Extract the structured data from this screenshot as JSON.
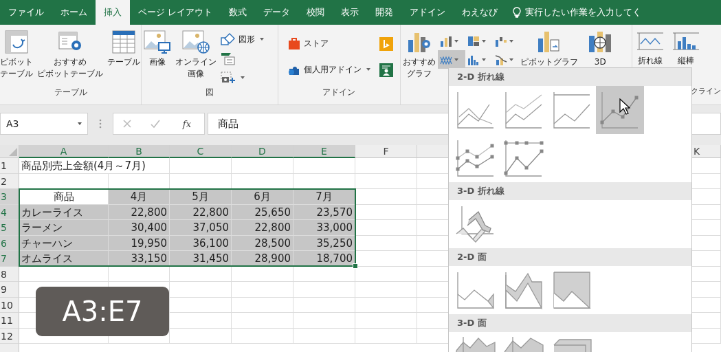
{
  "tabs": [
    {
      "label": "ファイル",
      "selected": false
    },
    {
      "label": "ホーム",
      "selected": false
    },
    {
      "label": "挿入",
      "selected": true
    },
    {
      "label": "ページ レイアウト",
      "selected": false
    },
    {
      "label": "数式",
      "selected": false
    },
    {
      "label": "データ",
      "selected": false
    },
    {
      "label": "校閲",
      "selected": false
    },
    {
      "label": "表示",
      "selected": false
    },
    {
      "label": "開発",
      "selected": false
    },
    {
      "label": "アドイン",
      "selected": false
    },
    {
      "label": "わえなび",
      "selected": false
    }
  ],
  "tell_me": "実行したい作業を入力してく",
  "ribbon": {
    "table_group": {
      "label": "テーブル",
      "buttons": [
        [
          "ピボット",
          "テーブル"
        ],
        [
          "おすすめ",
          "ピボットテーブル"
        ],
        [
          "テーブル"
        ]
      ]
    },
    "image_group": {
      "label": "図",
      "buttons": [
        [
          "画像"
        ],
        [
          "オンライン",
          "画像"
        ]
      ],
      "shapes": "図形"
    },
    "addin_group": {
      "label": "アドイン",
      "store": "ストア",
      "my_addins": "個人用アドイン"
    },
    "chart_group": {
      "recommended": [
        "おすすめ",
        "グラフ"
      ],
      "line_menu_open": true,
      "pivot_chart": "ピボットグラフ",
      "map_3d": "3D"
    },
    "sparkline_group": {
      "label": "クライン",
      "buttons": [
        "折れ線",
        "縦棒"
      ]
    }
  },
  "formula_bar": {
    "name_box": "A3",
    "fx": "fx",
    "formula": "商品"
  },
  "sheet": {
    "columns": [
      {
        "label": "A",
        "selected": true
      },
      {
        "label": "B",
        "selected": true
      },
      {
        "label": "C",
        "selected": true
      },
      {
        "label": "D",
        "selected": true
      },
      {
        "label": "E",
        "selected": true
      },
      {
        "label": "F",
        "selected": false
      }
    ],
    "far_column": {
      "label": "K",
      "selected": false
    },
    "rows": [
      {
        "label": "1",
        "selected": false,
        "kind": "title",
        "title": "商品別売上金額(4月～7月)"
      },
      {
        "label": "2",
        "selected": false,
        "kind": "blank"
      },
      {
        "label": "3",
        "selected": true,
        "kind": "header",
        "item": "商品",
        "active": true,
        "values": [
          "4月",
          "5月",
          "6月",
          "7月"
        ]
      },
      {
        "label": "4",
        "selected": true,
        "kind": "data",
        "item": "カレーライス",
        "active": false,
        "values": [
          "22,800",
          "22,800",
          "25,650",
          "23,570"
        ]
      },
      {
        "label": "5",
        "selected": true,
        "kind": "data",
        "item": "ラーメン",
        "active": false,
        "values": [
          "30,400",
          "37,050",
          "22,800",
          "33,000"
        ]
      },
      {
        "label": "6",
        "selected": true,
        "kind": "data",
        "item": "チャーハン",
        "active": false,
        "values": [
          "19,950",
          "36,100",
          "28,500",
          "35,250"
        ]
      },
      {
        "label": "7",
        "selected": true,
        "kind": "data",
        "item": "オムライス",
        "active": false,
        "values": [
          "33,150",
          "31,450",
          "28,900",
          "18,700"
        ]
      },
      {
        "label": "8",
        "selected": false,
        "kind": "blank"
      },
      {
        "label": "9",
        "selected": false,
        "kind": "blank"
      },
      {
        "label": "10",
        "selected": false,
        "kind": "blank"
      },
      {
        "label": "11",
        "selected": false,
        "kind": "blank"
      },
      {
        "label": "12",
        "selected": false,
        "kind": "blank"
      }
    ],
    "range_caption": "A3:E7"
  },
  "chart_menu": {
    "sections": [
      {
        "title": "2-D 折れ線",
        "options": [
          {
            "kind": "line",
            "selected": false
          },
          {
            "kind": "stacked-line",
            "selected": false
          },
          {
            "kind": "percent-line",
            "selected": false
          },
          {
            "kind": "line-markers",
            "selected": true
          },
          {
            "kind": "stacked-line-markers",
            "selected": false
          },
          {
            "kind": "percent-line-markers",
            "selected": false
          }
        ]
      },
      {
        "title": "3-D 折れ線",
        "options": [
          {
            "kind": "line-3d",
            "selected": false
          }
        ]
      },
      {
        "title": "2-D 面",
        "options": [
          {
            "kind": "area",
            "selected": false
          },
          {
            "kind": "stacked-area",
            "selected": false
          },
          {
            "kind": "percent-area",
            "selected": false
          }
        ]
      },
      {
        "title": "3-D 面",
        "options": [
          {
            "kind": "area-3d",
            "selected": false
          },
          {
            "kind": "stacked-area-3d",
            "selected": false
          },
          {
            "kind": "percent-area-3d",
            "selected": false
          }
        ]
      }
    ]
  }
}
